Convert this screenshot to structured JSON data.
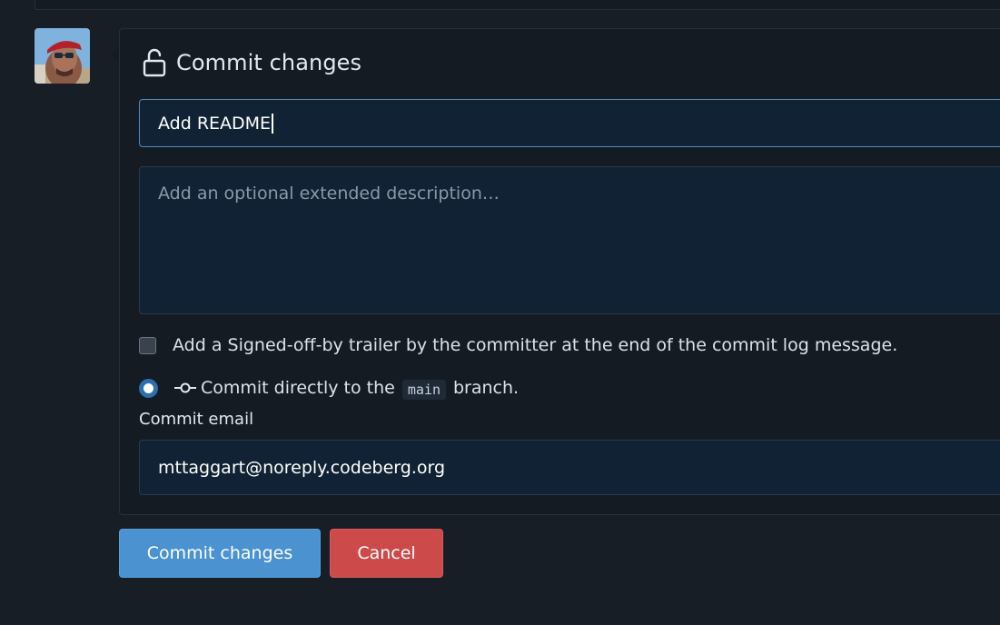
{
  "avatar": {
    "alt": "User avatar"
  },
  "commit_box": {
    "title": "Commit changes",
    "summary_value": "Add README",
    "description_placeholder": "Add an optional extended description…",
    "signoff_label": "Add a Signed-off-by trailer by the committer at the end of the commit log message.",
    "direct_prefix": "Commit directly to the",
    "branch_name": "main",
    "direct_suffix": "branch.",
    "email_label": "Commit email",
    "email_value": "mttaggart@noreply.codeberg.org"
  },
  "buttons": {
    "commit_label": "Commit changes",
    "cancel_label": "Cancel"
  },
  "colors": {
    "page_bg": "#171e26",
    "primary_button": "#4a92d0",
    "danger_button": "#cc4a4a",
    "input_bg": "#102233",
    "focus_border": "#4d8dc2"
  },
  "icons": {
    "header_icon": "unlock-icon",
    "commit_icon": "git-commit-icon"
  }
}
